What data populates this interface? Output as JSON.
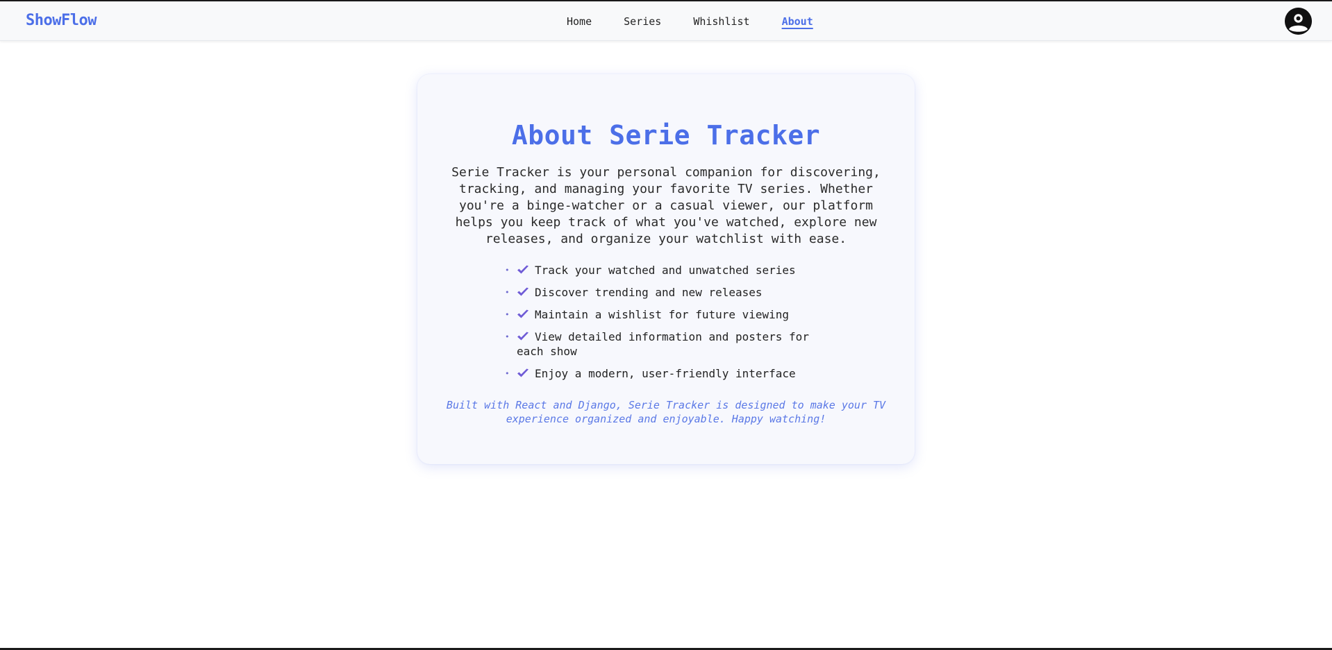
{
  "nav": {
    "brand": "ShowFlow",
    "links": [
      {
        "label": "Home",
        "active": false
      },
      {
        "label": "Series",
        "active": false
      },
      {
        "label": "Whishlist",
        "active": false
      },
      {
        "label": "About",
        "active": true
      }
    ],
    "avatar_icon": "user-circle-icon"
  },
  "about": {
    "title": "About Serie Tracker",
    "intro": "Serie Tracker is your personal companion for discovering, tracking, and managing your favorite TV series. Whether you're a binge-watcher or a casual viewer, our platform helps you keep track of what you've watched, explore new releases, and organize your watchlist with ease.",
    "features": [
      "Track your watched and unwatched series",
      "Discover trending and new releases",
      "Maintain a wishlist for future viewing",
      "View detailed information and posters for each show",
      "Enjoy a modern, user-friendly interface"
    ],
    "feature_icon": "check-icon",
    "footer": "Built with React and Django, Serie Tracker is designed to make your TV experience organized and enjoyable. Happy watching!"
  },
  "colors": {
    "accent": "#4c6fe8",
    "check": "#6f5bd6",
    "card_bg": "#f7f8fd"
  }
}
